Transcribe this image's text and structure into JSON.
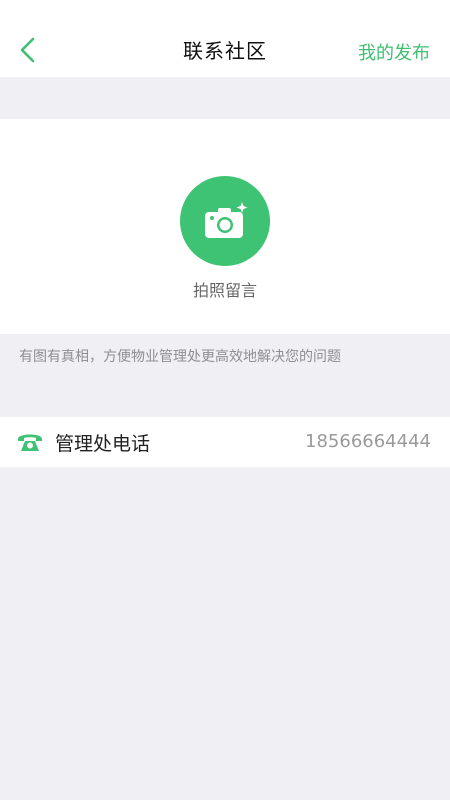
{
  "header": {
    "back_icon": "chevron-left-icon",
    "title": "联系社区",
    "action_label": "我的发布",
    "accent_color": "#3ebf72"
  },
  "photo": {
    "icon": "camera-icon",
    "label": "拍照留言",
    "button_color": "#3ec273"
  },
  "hint": "有图有真相，方便物业管理处更高效地解决您的问题",
  "contact": {
    "icon": "phone-icon",
    "label": "管理处电话",
    "value": "18566664444"
  }
}
